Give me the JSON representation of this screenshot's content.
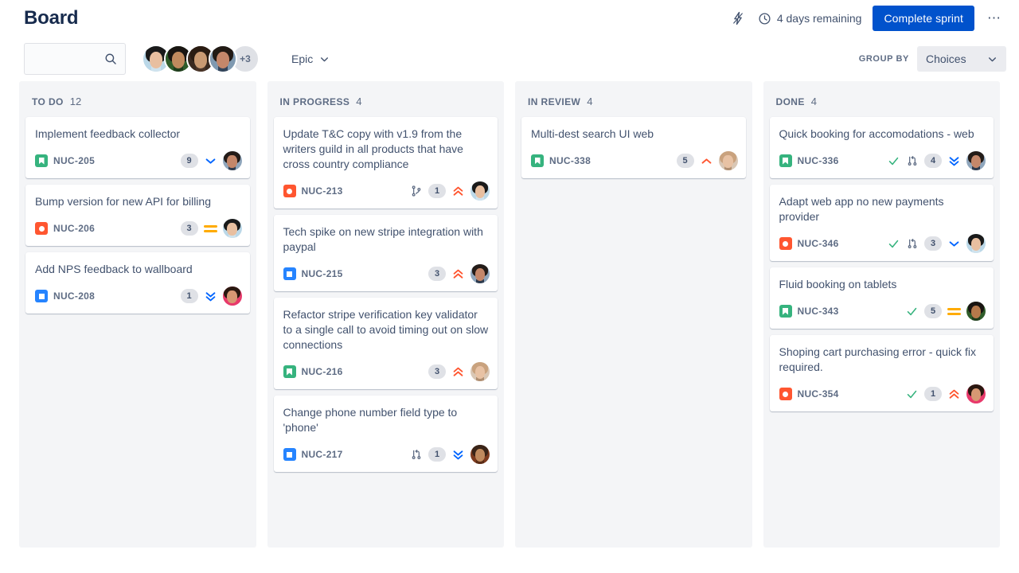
{
  "header": {
    "title": "Board",
    "lightning_icon": "lightning-icon",
    "clock_icon": "clock-icon",
    "days_remaining": "4 days remaining",
    "complete_sprint_label": "Complete sprint",
    "more_actions_icon": "more-actions-icon",
    "accent_color": "#0052CC"
  },
  "toolbar": {
    "search_value": "",
    "search_placeholder": "",
    "search_icon": "search-icon",
    "avatars_overflow": "+3",
    "epic_label": "Epic",
    "epic_chevron_icon": "chevron-down-icon",
    "group_by_label": "GROUP BY",
    "group_by_value": "Choices",
    "group_by_chevron_icon": "chevron-down-icon"
  },
  "columns": [
    {
      "name": "TO DO",
      "count": "12",
      "cards": [
        {
          "title": "Implement feedback collector",
          "key": "NUC-205",
          "type": "story",
          "type_icon": "story-icon",
          "points": "9",
          "priority": "low",
          "priority_icon": "priority-low-icon",
          "has_check": false,
          "dev_icon": "",
          "avatar": {
            "bg": "#8FA6BC",
            "hair": "#241C18",
            "skin": "#C4876A",
            "neck": "#2E3B4E"
          }
        },
        {
          "title": "Bump version for new API for billing",
          "key": "NUC-206",
          "type": "bug",
          "type_icon": "bug-icon",
          "points": "3",
          "priority": "medium",
          "priority_icon": "priority-medium-icon",
          "has_check": false,
          "dev_icon": "",
          "avatar": {
            "bg": "#BBD8E8",
            "hair": "#1A1A1A",
            "skin": "#E8BFA0",
            "neck": "#CFE3EE"
          }
        },
        {
          "title": "Add NPS feedback to wallboard",
          "key": "NUC-208",
          "type": "task",
          "type_icon": "task-icon",
          "points": "1",
          "priority": "lowest",
          "priority_icon": "priority-lowest-icon",
          "has_check": false,
          "dev_icon": "",
          "avatar": {
            "bg": "#E8396B",
            "hair": "#2A1810",
            "skin": "#D79873",
            "neck": "#E8396B"
          }
        }
      ]
    },
    {
      "name": "IN PROGRESS",
      "count": "4",
      "cards": [
        {
          "title": "Update T&C copy with v1.9 from the writers guild in all products that have cross country compliance",
          "key": "NUC-213",
          "type": "bug",
          "type_icon": "bug-icon",
          "points": "1",
          "priority": "highest",
          "priority_icon": "priority-highest-icon",
          "has_check": false,
          "dev_icon": "branch-icon",
          "avatar": {
            "bg": "#BBD8E8",
            "hair": "#1A1A1A",
            "skin": "#E8BFA0",
            "neck": "#CFE3EE"
          }
        },
        {
          "title": "Tech spike on new stripe integration with paypal",
          "key": "NUC-215",
          "type": "task",
          "type_icon": "task-icon",
          "points": "3",
          "priority": "highest",
          "priority_icon": "priority-highest-icon",
          "has_check": false,
          "dev_icon": "",
          "avatar": {
            "bg": "#8FA6BC",
            "hair": "#241C18",
            "skin": "#C4876A",
            "neck": "#2E3B4E"
          }
        },
        {
          "title": "Refactor stripe verification key validator to a single call to avoid timing out on slow connections",
          "key": "NUC-216",
          "type": "story",
          "type_icon": "story-icon",
          "points": "3",
          "priority": "highest",
          "priority_icon": "priority-highest-icon",
          "has_check": false,
          "dev_icon": "",
          "avatar": {
            "bg": "#D9C7B5",
            "hair": "#C9A27E",
            "skin": "#E8C2A4",
            "neck": "#B08F72"
          }
        },
        {
          "title": "Change phone number field type to 'phone'",
          "key": "NUC-217",
          "type": "task",
          "type_icon": "task-icon",
          "points": "1",
          "priority": "lowest",
          "priority_icon": "priority-lowest-icon",
          "has_check": false,
          "dev_icon": "pull-request-icon",
          "avatar": {
            "bg": "#7C3A1E",
            "hair": "#3A2418",
            "skin": "#C08A5E",
            "neck": "#5A2C16"
          }
        }
      ]
    },
    {
      "name": "IN REVIEW",
      "count": "4",
      "cards": [
        {
          "title": "Multi-dest search UI web",
          "key": "NUC-338",
          "type": "story",
          "type_icon": "story-icon",
          "points": "5",
          "priority": "high",
          "priority_icon": "priority-high-icon",
          "has_check": false,
          "dev_icon": "",
          "avatar": {
            "bg": "#D9C7B5",
            "hair": "#C9A27E",
            "skin": "#E8C2A4",
            "neck": "#B08F72"
          }
        }
      ]
    },
    {
      "name": "DONE",
      "count": "4",
      "cards": [
        {
          "title": "Quick booking for accomodations - web",
          "key": "NUC-336",
          "type": "story",
          "type_icon": "story-icon",
          "points": "4",
          "priority": "lowest",
          "priority_icon": "priority-lowest-icon",
          "has_check": true,
          "dev_icon": "pull-request-icon",
          "avatar": {
            "bg": "#8FA6BC",
            "hair": "#241C18",
            "skin": "#C4876A",
            "neck": "#2E3B4E"
          }
        },
        {
          "title": "Adapt web app no new payments provider",
          "key": "NUC-346",
          "type": "bug",
          "type_icon": "bug-icon",
          "points": "3",
          "priority": "low",
          "priority_icon": "priority-low-icon",
          "has_check": true,
          "dev_icon": "pull-request-icon",
          "avatar": {
            "bg": "#BBD8E8",
            "hair": "#1A1A1A",
            "skin": "#E8BFA0",
            "neck": "#CFE3EE"
          }
        },
        {
          "title": "Fluid booking on tablets",
          "key": "NUC-343",
          "type": "story",
          "type_icon": "story-icon",
          "points": "5",
          "priority": "medium",
          "priority_icon": "priority-medium-icon",
          "has_check": true,
          "dev_icon": "",
          "avatar": {
            "bg": "#2F5C2A",
            "hair": "#191512",
            "skin": "#B5794B",
            "neck": "#1F3D1C"
          }
        },
        {
          "title": "Shoping cart purchasing error - quick fix required.",
          "key": "NUC-354",
          "type": "bug",
          "type_icon": "bug-icon",
          "points": "1",
          "priority": "highest",
          "priority_icon": "priority-highest-icon",
          "has_check": true,
          "dev_icon": "",
          "avatar": {
            "bg": "#E8396B",
            "hair": "#2A1810",
            "skin": "#D79873",
            "neck": "#E8396B"
          }
        }
      ]
    }
  ],
  "toolbar_avatars": [
    {
      "bg": "#BBD8E8",
      "hair": "#1A1A1A",
      "skin": "#E8BFA0",
      "neck": "#CFE3EE"
    },
    {
      "bg": "#2F5C2A",
      "hair": "#191512",
      "skin": "#C08A5E",
      "neck": "#1F3D1C"
    },
    {
      "bg": "#3A2A20",
      "hair": "#2A1C12",
      "skin": "#C99A72",
      "neck": "#4A3528"
    },
    {
      "bg": "#7F99B0",
      "hair": "#221A14",
      "skin": "#C4876A",
      "neck": "#33445A"
    }
  ],
  "colors": {
    "priority_high": "#FF5630",
    "priority_low": "#0065FF",
    "priority_medium": "#FFAB00",
    "done_check": "#36B37E",
    "column_bg": "#F4F5F7"
  }
}
